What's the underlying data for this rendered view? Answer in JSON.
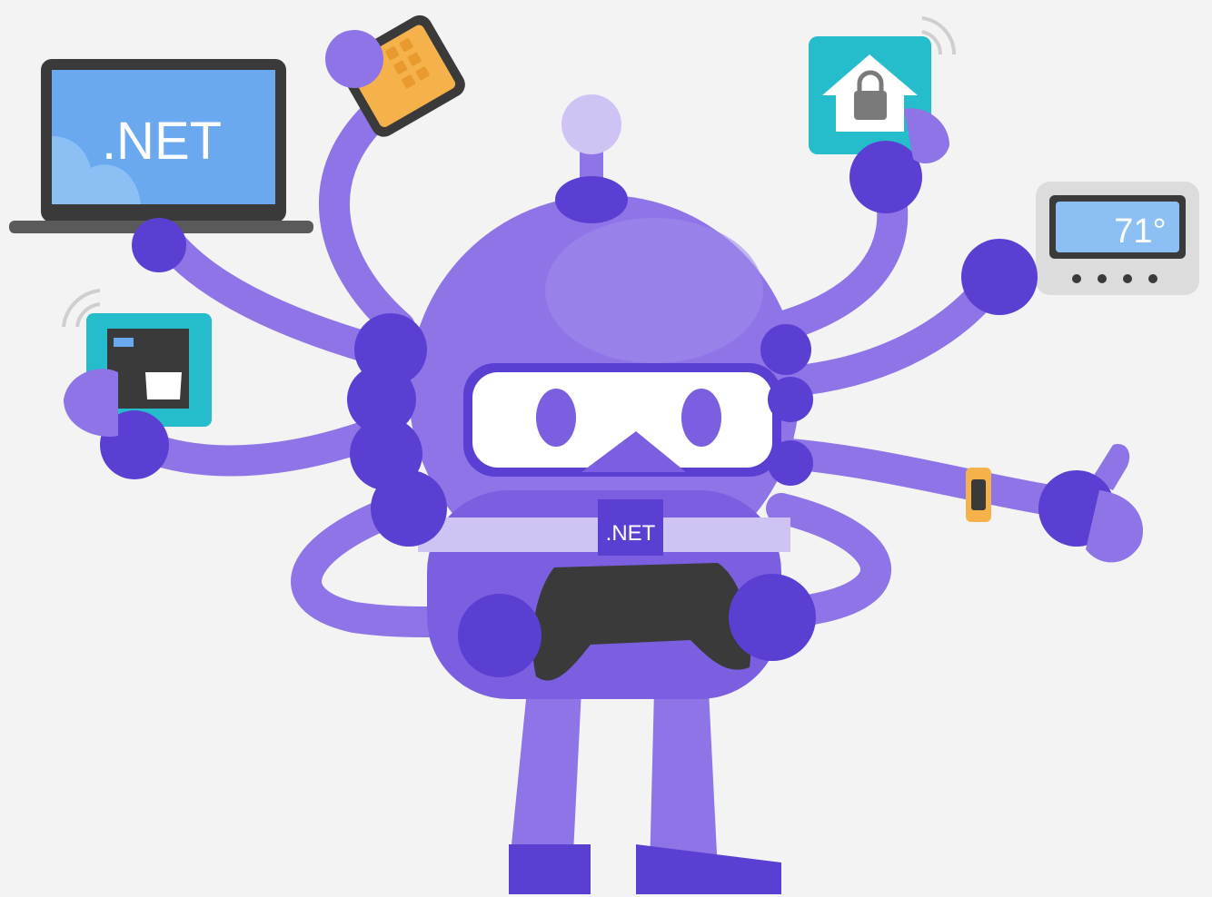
{
  "laptop": {
    "screen_text": ".NET"
  },
  "mascot": {
    "badge_text": ".NET"
  },
  "thermostat": {
    "temperature": "71°"
  },
  "colors": {
    "background": "#f3f3f3",
    "body_purple": "#8e74e6",
    "dark_purple": "#5b3fd3",
    "light_purple": "#cfc3f3",
    "screen_blue": "#6aa8ef",
    "teal": "#25bccb",
    "orange": "#f5b24a",
    "dark_gray": "#3a3a3a"
  }
}
